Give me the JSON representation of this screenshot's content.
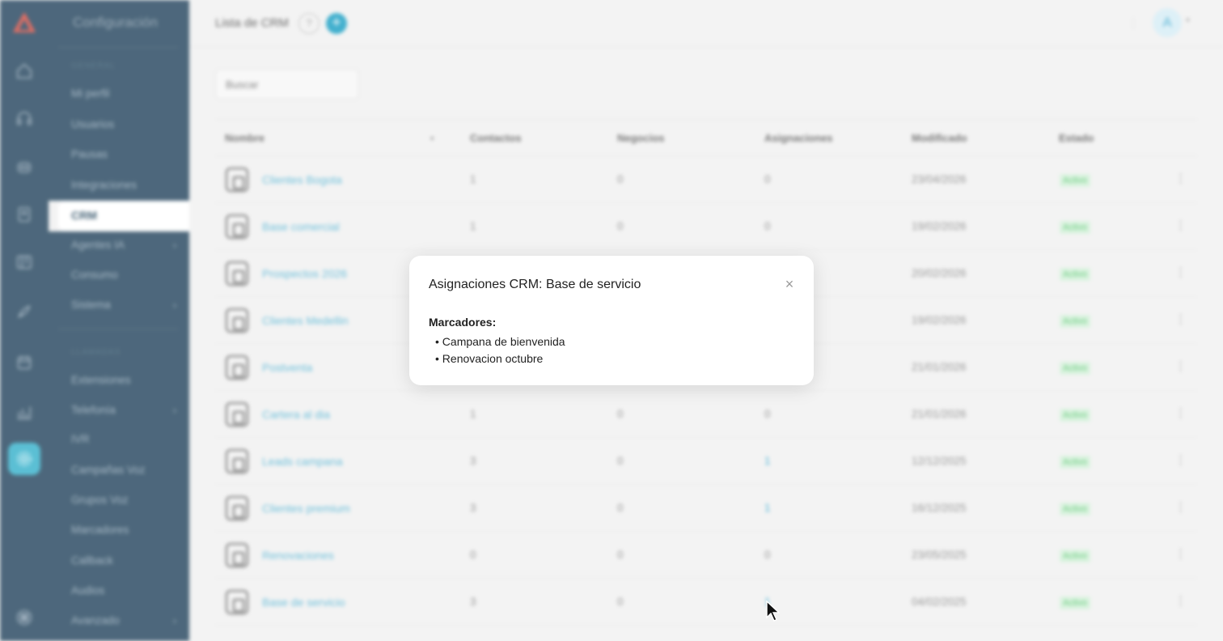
{
  "sidebar": {
    "section_title": "Configuración",
    "section_general": "GENERAL",
    "section_llamadas": "LLAMADAS",
    "general_items": [
      {
        "label": "Mi perfil"
      },
      {
        "label": "Usuarios"
      },
      {
        "label": "Pausas"
      },
      {
        "label": "Integraciones"
      }
    ],
    "active_item": "CRM",
    "after_items": [
      {
        "label": "Agentes IA",
        "chevron": "›"
      },
      {
        "label": "Consumo",
        "chevron": ""
      },
      {
        "label": "Sistema",
        "chevron": "›"
      }
    ],
    "llamadas_items": [
      {
        "label": "Extensiones",
        "chevron": ""
      },
      {
        "label": "Telefonía",
        "chevron": "›"
      },
      {
        "label": "IVR",
        "chevron": ""
      },
      {
        "label": "Campañas Voz",
        "chevron": ""
      },
      {
        "label": "Grupos Voz",
        "chevron": ""
      },
      {
        "label": "Marcadores",
        "chevron": ""
      },
      {
        "label": "Callback",
        "chevron": ""
      },
      {
        "label": "Audios",
        "chevron": ""
      },
      {
        "label": "Avanzado",
        "chevron": "›"
      }
    ]
  },
  "header": {
    "title": "Lista de CRM",
    "help_label": "?",
    "add_label": "+",
    "avatar_initial": "A",
    "dots": "⋮",
    "caret": "▾"
  },
  "search": {
    "placeholder": "Buscar"
  },
  "table": {
    "columns": [
      "Nombre",
      "Contactos",
      "Negocios",
      "Asignaciones",
      "Modificado",
      "Estado"
    ],
    "sort_indicator": "▾",
    "rows": [
      {
        "name": "Clientes Bogota",
        "contactos": "1",
        "negocios": "0",
        "asignaciones": "0",
        "modificado": "23/04/2026",
        "estado": "Activo"
      },
      {
        "name": "Base comercial",
        "contactos": "1",
        "negocios": "0",
        "asignaciones": "0",
        "modificado": "19/02/2026",
        "estado": "Activo"
      },
      {
        "name": "Prospectos 2026",
        "contactos": "",
        "negocios": "",
        "asignaciones": "",
        "modificado": "20/02/2026",
        "estado": "Activo"
      },
      {
        "name": "Clientes Medellin",
        "contactos": "",
        "negocios": "",
        "asignaciones": "",
        "modificado": "19/02/2026",
        "estado": "Activo"
      },
      {
        "name": "Postventa",
        "contactos": "",
        "negocios": "",
        "asignaciones": "",
        "modificado": "21/01/2026",
        "estado": "Activo"
      },
      {
        "name": "Cartera al dia",
        "contactos": "1",
        "negocios": "0",
        "asignaciones": "0",
        "modificado": "21/01/2026",
        "estado": "Activo"
      },
      {
        "name": "Leads campana",
        "contactos": "3",
        "negocios": "0",
        "asignaciones": "1",
        "modificado": "12/12/2025",
        "estado": "Activo"
      },
      {
        "name": "Clientes premium",
        "contactos": "3",
        "negocios": "0",
        "asignaciones": "1",
        "modificado": "16/12/2025",
        "estado": "Activo"
      },
      {
        "name": "Renovaciones",
        "contactos": "0",
        "negocios": "0",
        "asignaciones": "0",
        "modificado": "23/05/2025",
        "estado": "Activo"
      },
      {
        "name": "Base de servicio",
        "contactos": "3",
        "negocios": "0",
        "asignaciones": "1",
        "modificado": "04/02/2025",
        "estado": "Activo"
      }
    ]
  },
  "modal": {
    "title": "Asignaciones CRM: Base de servicio",
    "close_label": "×",
    "section_label": "Marcadores:",
    "items": [
      "Campana de bienvenida",
      "Renovacion octubre"
    ]
  },
  "colors": {
    "sidebar_bg": "#35536a",
    "accent": "#2aa6c8",
    "link": "#5bb7d6",
    "status_active_bg": "#d6f2dc",
    "status_active_text": "#56c36d"
  }
}
